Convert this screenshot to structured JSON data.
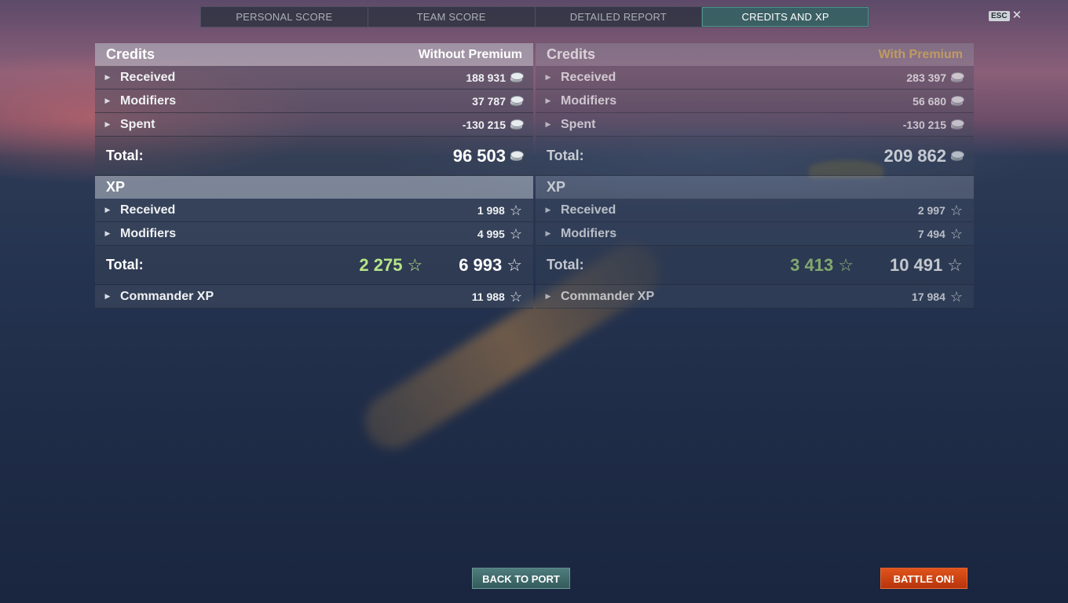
{
  "tabs": [
    {
      "label": "PERSONAL SCORE"
    },
    {
      "label": "TEAM SCORE"
    },
    {
      "label": "DETAILED REPORT"
    },
    {
      "label": "CREDITS AND XP",
      "active": true
    }
  ],
  "esc": {
    "key": "ESC",
    "close": "✕"
  },
  "left": {
    "credits_title": "Credits",
    "mode": "Without Premium",
    "credits_rows": [
      {
        "label": "Received",
        "value": "188 931"
      },
      {
        "label": "Modifiers",
        "value": "37 787"
      },
      {
        "label": "Spent",
        "value": "-130 215"
      }
    ],
    "credits_total_label": "Total:",
    "credits_total": "96 503",
    "xp_title": "XP",
    "xp_rows": [
      {
        "label": "Received",
        "value": "1 998"
      },
      {
        "label": "Modifiers",
        "value": "4 995"
      }
    ],
    "xp_total_label": "Total:",
    "xp_total_free": "2 275",
    "xp_total": "6 993",
    "commander_label": "Commander XP",
    "commander_value": "11 988"
  },
  "right": {
    "credits_title": "Credits",
    "mode": "With Premium",
    "credits_rows": [
      {
        "label": "Received",
        "value": "283 397"
      },
      {
        "label": "Modifiers",
        "value": "56 680"
      },
      {
        "label": "Spent",
        "value": "-130 215"
      }
    ],
    "credits_total_label": "Total:",
    "credits_total": "209 862",
    "xp_title": "XP",
    "xp_rows": [
      {
        "label": "Received",
        "value": "2 997"
      },
      {
        "label": "Modifiers",
        "value": "7 494"
      }
    ],
    "xp_total_label": "Total:",
    "xp_total_free": "3 413",
    "xp_total": "10 491",
    "commander_label": "Commander XP",
    "commander_value": "17 984"
  },
  "buttons": {
    "back_to_port": "BACK TO PORT",
    "battle_on": "BATTLE ON!"
  },
  "colors": {
    "accent_green": "#b6e58a",
    "premium_gold": "#d9b45a",
    "battle_orange": "#d4471a",
    "port_teal": "#44706f"
  }
}
